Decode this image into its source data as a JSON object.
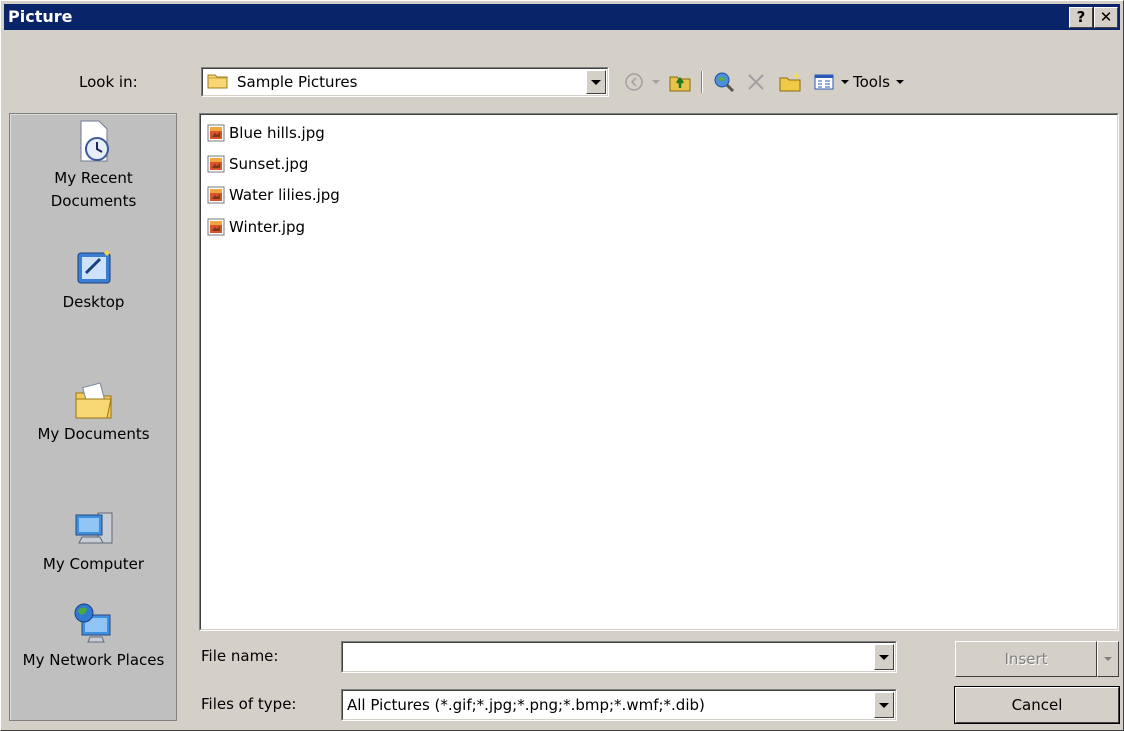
{
  "title": "Picture",
  "title_buttons": {
    "help": "?",
    "close": "✕"
  },
  "look_in": {
    "label": "Look in:",
    "value": "Sample Pictures"
  },
  "toolbar": {
    "tools_label": "Tools"
  },
  "places": [
    {
      "label": "My Recent Documents",
      "icon": "recent-documents-icon"
    },
    {
      "label": "Desktop",
      "icon": "desktop-icon"
    },
    {
      "label": "My Documents",
      "icon": "my-documents-icon"
    },
    {
      "label": "My Computer",
      "icon": "my-computer-icon"
    },
    {
      "label": "My Network Places",
      "icon": "network-places-icon"
    }
  ],
  "files": [
    "Blue hills.jpg",
    "Sunset.jpg",
    "Water lilies.jpg",
    "Winter.jpg"
  ],
  "file_name": {
    "label": "File name:",
    "value": ""
  },
  "files_of_type": {
    "label": "Files of type:",
    "value": "All Pictures (*.gif;*.jpg;*.png;*.bmp;*.wmf;*.dib)"
  },
  "buttons": {
    "insert": "Insert",
    "cancel": "Cancel"
  },
  "colors": {
    "titlebar": "#0a246a",
    "face": "#d4d0c8",
    "places_bg": "#bfbfbf"
  }
}
